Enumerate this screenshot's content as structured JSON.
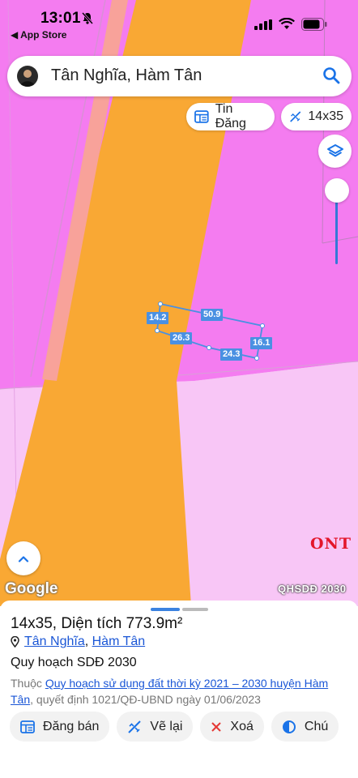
{
  "status_bar": {
    "time": "13:01",
    "back_app": "◀ App Store"
  },
  "search": {
    "query": "Tân Nghĩa, Hàm Tân"
  },
  "chips": {
    "news": "Tin Đăng",
    "size": "14x35"
  },
  "parcel": {
    "labels": {
      "left": "14.2",
      "top": "50.9",
      "right": "16.1",
      "bottom_left": "26.3",
      "bottom_right": "24.3"
    }
  },
  "map": {
    "zone_code": "ONT",
    "google": "Google",
    "plan_badge": "QHSDĐ 2030"
  },
  "sheet": {
    "title": "14x35, Diện tích 773.9m²",
    "location": {
      "commune": "Tân Nghĩa",
      "separator": ",",
      "district": "Hàm Tân"
    },
    "plan_title": "Quy hoạch SDĐ 2030",
    "desc_prefix": "Thuộc",
    "desc_link": "Quy hoạch sử dụng đất thời kỳ 2021 – 2030 huyện Hàm Tân",
    "desc_suffix": ", quyết định 1021/QĐ-UBND ngày 01/06/2023",
    "actions": {
      "sell": "Đăng bán",
      "redraw": "Vẽ lại",
      "delete": "Xoá",
      "note": "Chú"
    }
  },
  "colors": {
    "road": "#f9a834",
    "residential": "#f47cf0",
    "light_zone": "#f8c8f6",
    "accent": "#1a56d6",
    "ont": "#e3162b"
  }
}
